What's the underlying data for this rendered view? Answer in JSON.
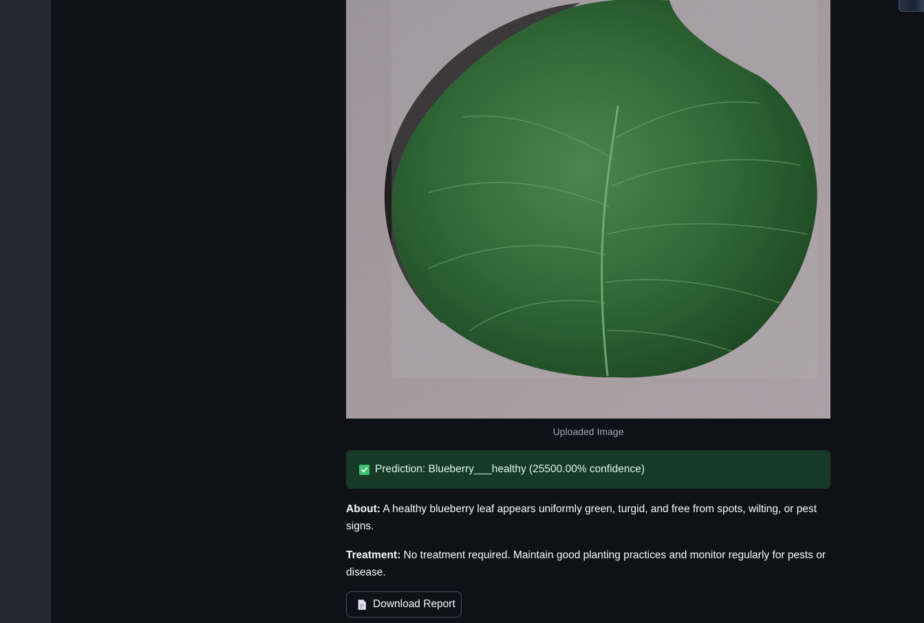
{
  "image": {
    "caption": "Uploaded Image"
  },
  "result": {
    "prediction": "Prediction: Blueberry___healthy (25500.00% confidence)",
    "status_color": "#173928",
    "check_icon": "check-box-icon"
  },
  "about": {
    "label": "About:",
    "text": " A healthy blueberry leaf appears uniformly green, turgid, and free from spots, wilting, or pest signs."
  },
  "treatment": {
    "label": "Treatment:",
    "text": " No treatment required. Maintain good planting practices and monitor regularly for pests or disease."
  },
  "download": {
    "label": "Download Report",
    "icon": "document-icon"
  }
}
